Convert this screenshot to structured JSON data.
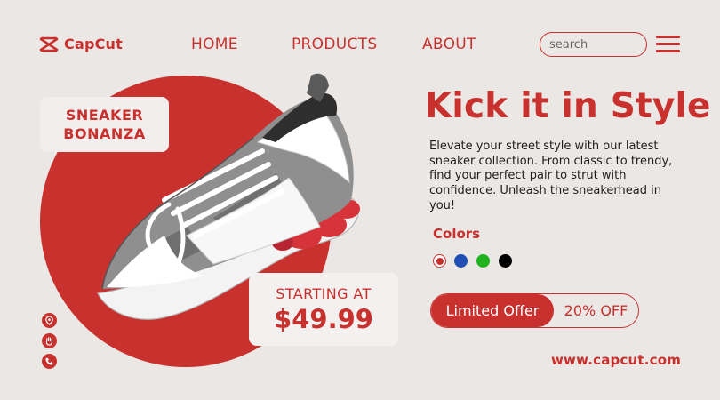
{
  "header": {
    "logo_text": "CapCut",
    "logo_icon": "capcut-logo-icon",
    "nav": [
      "HOME",
      "PRODUCTS",
      "ABOUT"
    ],
    "search_placeholder": "search",
    "menu_icon": "hamburger-menu-icon"
  },
  "hero": {
    "badge_line1": "SNEAKER",
    "badge_line2": "BONANZA",
    "price_label": "STARTING AT",
    "price_value": "$49.99"
  },
  "content": {
    "headline": "Kick it in Style",
    "description": "Elevate your street style with our latest sneaker collection. From classic to trendy, find your perfect pair to strut with confidence. Unleash the sneakerhead in you!",
    "colors_label": "Colors",
    "colors": [
      "#c8312d",
      "#1f4fb4",
      "#1fb41f",
      "#000000"
    ],
    "offer_label": "Limited Offer",
    "offer_value": "20% OFF",
    "website": "www.capcut.com"
  },
  "side_icons": [
    "location-icon",
    "hand-icon",
    "phone-icon"
  ],
  "theme": {
    "accent": "#c8312d",
    "background": "#ebe7e5"
  }
}
